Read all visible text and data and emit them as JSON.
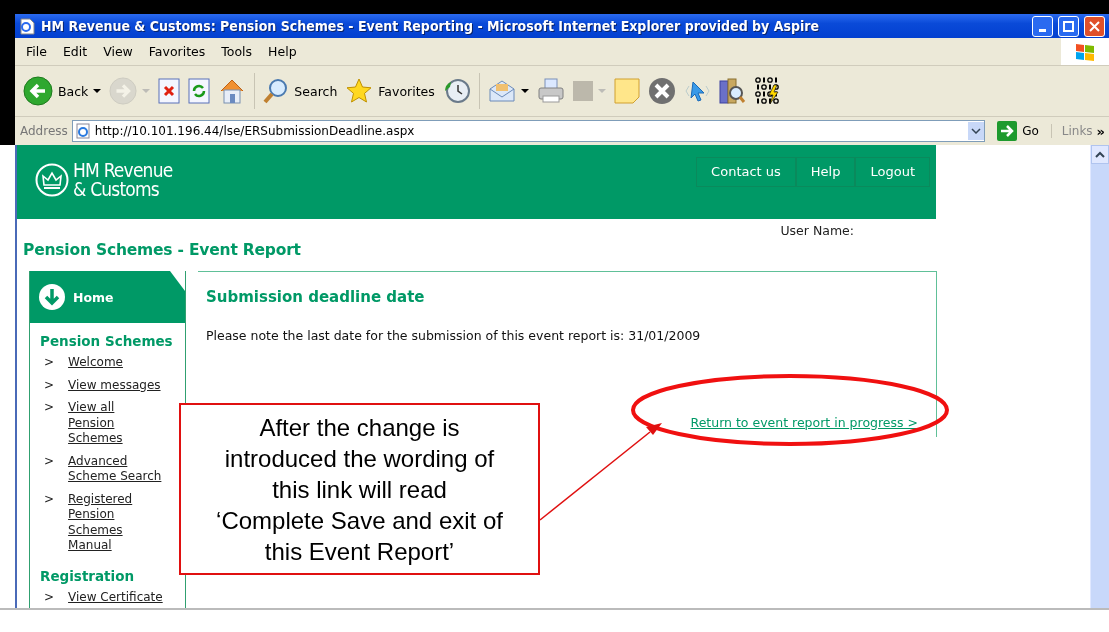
{
  "window": {
    "title": "HM Revenue & Customs: Pension Schemes - Event Reporting - Microsoft Internet Explorer provided by Aspire"
  },
  "menu": [
    "File",
    "Edit",
    "View",
    "Favorites",
    "Tools",
    "Help"
  ],
  "toolbar": [
    {
      "kind": "back",
      "label": "Back",
      "caret": true
    },
    {
      "kind": "forward",
      "caret": true,
      "disabled": true
    },
    {
      "kind": "stop"
    },
    {
      "kind": "refresh"
    },
    {
      "kind": "home"
    },
    {
      "kind": "search",
      "label": "Search"
    },
    {
      "kind": "favorites",
      "label": "Favorites"
    },
    {
      "kind": "history"
    },
    {
      "kind": "mail",
      "caret": true
    },
    {
      "kind": "print"
    },
    {
      "kind": "square",
      "caret": true,
      "disabled": true
    },
    {
      "kind": "note"
    },
    {
      "kind": "x-circle"
    },
    {
      "kind": "cursor"
    },
    {
      "kind": "research"
    },
    {
      "kind": "binary"
    }
  ],
  "address": {
    "label": "Address",
    "value": "http://10.101.196.44/lse/ERSubmissionDeadline.aspx",
    "go": "Go",
    "links": "Links",
    "more": "»"
  },
  "header": {
    "logo_lines": [
      "HM Revenue",
      "& Customs"
    ],
    "nav": [
      "Contact us",
      "Help",
      "Logout"
    ]
  },
  "user_label": "User Name:",
  "page_title": "Pension Schemes - Event Report",
  "sidebar": {
    "home": "Home",
    "sections": [
      {
        "title": "Pension Schemes",
        "items": [
          "Welcome",
          "View messages",
          "View all Pension Schemes",
          "Advanced Scheme Search",
          "Registered Pension Schemes Manual"
        ]
      },
      {
        "title": "Registration",
        "items": [
          "View Certificate"
        ]
      }
    ],
    "bullet": ">"
  },
  "main": {
    "heading": "Submission deadline date",
    "message": "Please note the last date for the submission of this event report is: 31/01/2009",
    "link": "Return to event report in progress >"
  },
  "annotation": {
    "lines": [
      "After the change is",
      "introduced the wording of",
      "this link will read",
      "‘Complete Save and exit of",
      "this Event Report’"
    ]
  }
}
